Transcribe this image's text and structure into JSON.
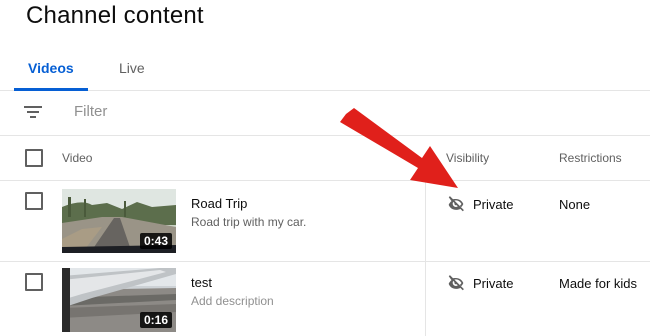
{
  "page": {
    "title": "Channel content"
  },
  "tabs": [
    {
      "label": "Videos",
      "active": true
    },
    {
      "label": "Live",
      "active": false
    }
  ],
  "filter": {
    "placeholder": "Filter",
    "icon": "filter-icon"
  },
  "table": {
    "headers": {
      "video": "Video",
      "visibility": "Visibility",
      "restrictions": "Restrictions"
    },
    "rows": [
      {
        "title": "Road Trip",
        "description": "Road trip with my car.",
        "duration": "0:43",
        "visibility": "Private",
        "visibility_icon": "eye-off-icon",
        "restrictions": "None"
      },
      {
        "title": "test",
        "description": "Add description",
        "duration": "0:16",
        "visibility": "Private",
        "visibility_icon": "eye-off-icon",
        "restrictions": "Made for kids"
      }
    ]
  },
  "colors": {
    "accent": "#065fd4",
    "annotation_arrow": "#e0201b"
  }
}
